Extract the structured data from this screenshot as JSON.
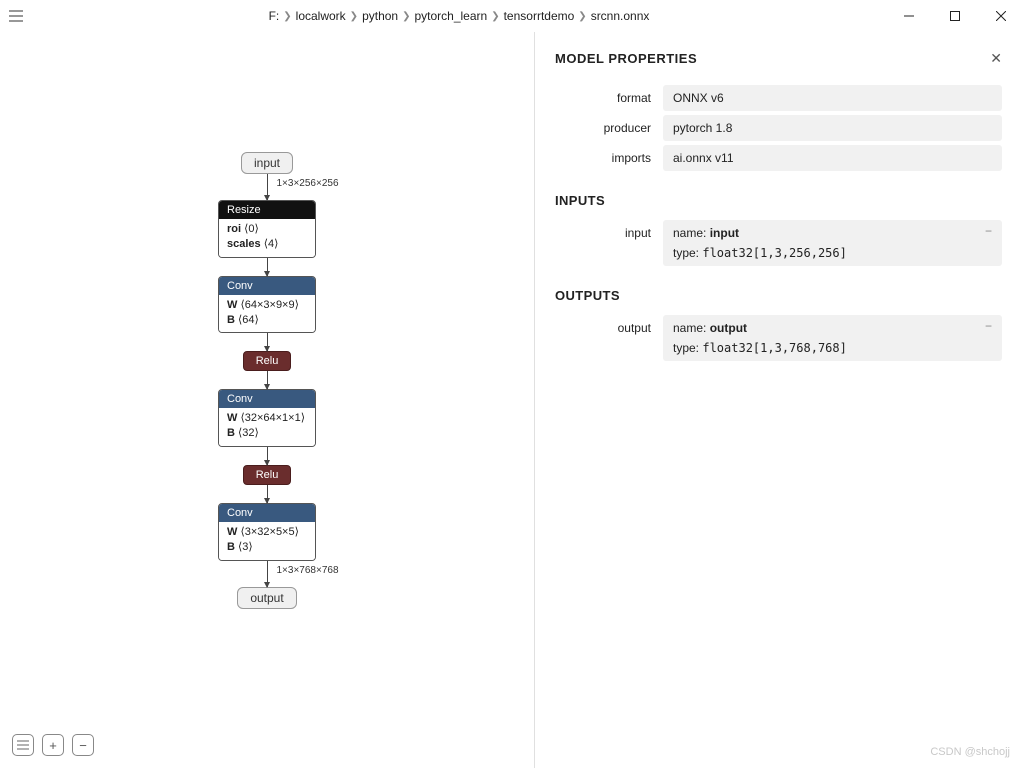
{
  "breadcrumb": [
    "F:",
    "localwork",
    "python",
    "pytorch_learn",
    "tensorrtdemo",
    "srcnn.onnx"
  ],
  "graph": {
    "input_node": "input",
    "input_shape": "1×3×256×256",
    "nodes": [
      {
        "type": "op-black",
        "title": "Resize",
        "lines": [
          [
            "roi",
            "⟨0⟩"
          ],
          [
            "scales",
            "⟨4⟩"
          ]
        ]
      },
      {
        "type": "op-blue",
        "title": "Conv",
        "lines": [
          [
            "W",
            "⟨64×3×9×9⟩"
          ],
          [
            "B",
            "⟨64⟩"
          ]
        ]
      },
      {
        "type": "relu",
        "title": "Relu"
      },
      {
        "type": "op-blue",
        "title": "Conv",
        "lines": [
          [
            "W",
            "⟨32×64×1×1⟩"
          ],
          [
            "B",
            "⟨32⟩"
          ]
        ]
      },
      {
        "type": "relu",
        "title": "Relu"
      },
      {
        "type": "op-blue",
        "title": "Conv",
        "lines": [
          [
            "W",
            "⟨3×32×5×5⟩"
          ],
          [
            "B",
            "⟨3⟩"
          ]
        ]
      }
    ],
    "output_shape": "1×3×768×768",
    "output_node": "output"
  },
  "panel": {
    "title": "MODEL PROPERTIES",
    "props": {
      "format_label": "format",
      "format_value": "ONNX v6",
      "producer_label": "producer",
      "producer_value": "pytorch 1.8",
      "imports_label": "imports",
      "imports_value": "ai.onnx v11"
    },
    "inputs_heading": "INPUTS",
    "input": {
      "label": "input",
      "name_k": "name:",
      "name_v": "input",
      "type_k": "type:",
      "type_v": "float32[1,3,256,256]"
    },
    "outputs_heading": "OUTPUTS",
    "output": {
      "label": "output",
      "name_k": "name:",
      "name_v": "output",
      "type_k": "type:",
      "type_v": "float32[1,3,768,768]"
    }
  },
  "watermark": "CSDN @shchojj"
}
